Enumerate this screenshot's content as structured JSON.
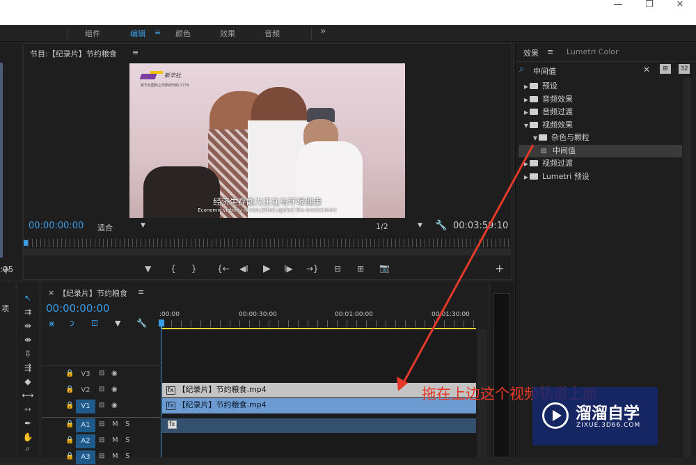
{
  "window": {
    "minimize": "—",
    "restore": "❐",
    "close": "✕"
  },
  "workspaces": {
    "tabs": [
      "组件",
      "编辑",
      "颜色",
      "效果",
      "音频"
    ],
    "active_menu": "≡",
    "more": "»"
  },
  "program": {
    "title": "节目:【纪录片】节约粮食",
    "menu": "≡",
    "timecode": "00:00:00:00",
    "fit": "适合",
    "resolution": "1/2",
    "duration": "00:03:59:10",
    "left_timecode": ":05",
    "add": "+"
  },
  "video": {
    "logo_text": "新华社",
    "small_text": "新华社国际上传新闻代码:1779",
    "subtitle_cn": "经济生存能力正在与环境健康",
    "subtitle_en": "Economic viability is now pitted against the environment"
  },
  "transport": {
    "marker": "▼",
    "in": "{",
    "out": "}",
    "goto_in": "{←",
    "step_back": "◀I",
    "play": "▶",
    "step_fwd": "I▶",
    "goto_out": "→}",
    "lift": "⊟",
    "extract": "⊞",
    "export": "📷",
    "add": "+"
  },
  "effects": {
    "tab": "效果",
    "menu": "≡",
    "tab2": "Lumetri Color",
    "search": "中间值",
    "clear": "✕",
    "btn1": "⊞",
    "btn2": "32",
    "tree": [
      {
        "label": "预设",
        "indent": 0,
        "open": false
      },
      {
        "label": "音频效果",
        "indent": 0,
        "open": false
      },
      {
        "label": "音频过渡",
        "indent": 0,
        "open": false
      },
      {
        "label": "视频效果",
        "indent": 0,
        "open": true
      },
      {
        "label": "杂色与颗粒",
        "indent": 1,
        "open": true
      },
      {
        "label": "中间值",
        "indent": 2,
        "leaf": true
      },
      {
        "label": "视频过渡",
        "indent": 0,
        "open": false
      },
      {
        "label": "Lumetri 预设",
        "indent": 0,
        "open": false
      }
    ]
  },
  "timeline": {
    "close": "×",
    "title": "【纪录片】节约粮食",
    "menu": "≡",
    "timecode": "00:00:00:00",
    "ruler": [
      ":00:00",
      "00:00:30:00",
      "00:01:00:00",
      "00:01:30:00"
    ],
    "tracks": [
      "V3",
      "V2",
      "V1",
      "A1",
      "A2",
      "A3"
    ],
    "toggle": "M",
    "solo": "S",
    "clips": {
      "v2": "【纪录片】节约粮食.mp4",
      "v1": "【纪录片】节约粮食.mp4",
      "a1": "fx"
    }
  },
  "project": {
    "label": "项"
  },
  "annotation": {
    "text": "拖在上边这个视频轨道上面"
  },
  "watermark": {
    "cn": "溜溜自学",
    "en": "ZIXUE.3D66.COM"
  },
  "colors": {
    "accent": "#3b9de6",
    "annotation": "#e53a2a",
    "clip_v2": "#c4c4c4",
    "clip_v1": "#6b9bd1",
    "clip_a1": "#33506f"
  }
}
